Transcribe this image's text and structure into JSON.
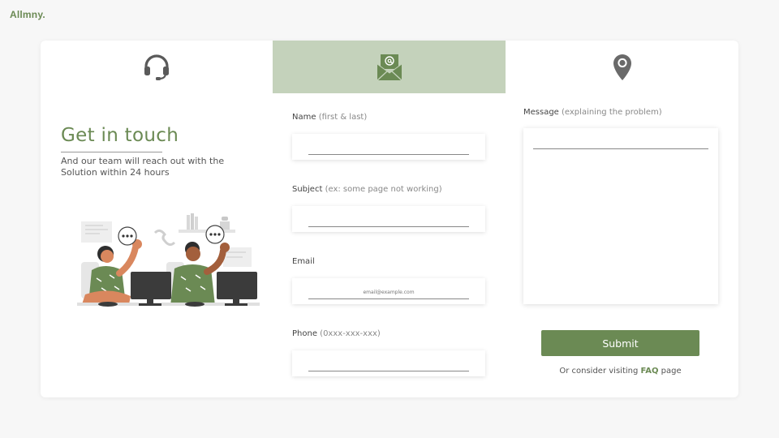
{
  "brand": {
    "logo": "Allmny."
  },
  "tabs": [
    {
      "icon": "headset-icon",
      "active": false
    },
    {
      "icon": "envelope-icon",
      "active": true
    },
    {
      "icon": "location-pin-icon",
      "active": false
    }
  ],
  "intro": {
    "title": "Get in touch",
    "subtitle": "And our team will reach out with the Solution within 24 hours"
  },
  "form": {
    "name": {
      "label": "Name",
      "hint": "(first & last)",
      "value": "",
      "placeholder": ""
    },
    "subject": {
      "label": "Subject",
      "hint": "(ex: some page not working)",
      "value": "",
      "placeholder": ""
    },
    "email": {
      "label": "Email",
      "hint": "",
      "value": "",
      "placeholder": "email@example.com"
    },
    "phone": {
      "label": "Phone",
      "hint": "(0xxx-xxx-xxx)",
      "value": "",
      "placeholder": ""
    },
    "message": {
      "label": "Message",
      "hint": "(explaining the problem)",
      "value": ""
    }
  },
  "actions": {
    "submit_label": "Submit",
    "faq_prefix": "Or consider visiting",
    "faq_link": "FAQ",
    "faq_suffix": "page"
  },
  "colors": {
    "accent": "#6b8a54",
    "active_tab": "#c4d2bb",
    "icon_gray": "#5a5a5a"
  }
}
